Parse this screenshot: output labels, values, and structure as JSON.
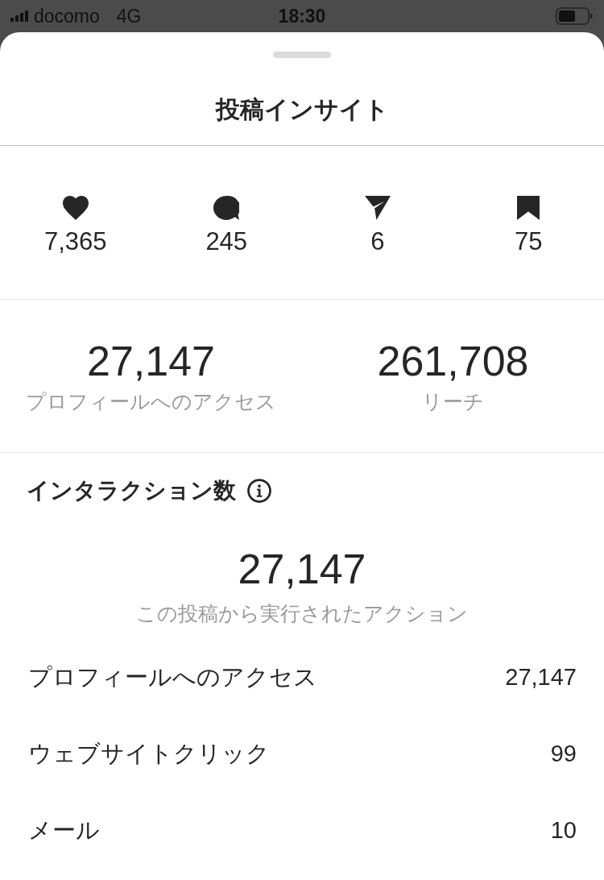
{
  "status_bar": {
    "carrier": "docomo",
    "network": "4G",
    "time": "18:30"
  },
  "sheet": {
    "title": "投稿インサイト"
  },
  "engagement": [
    {
      "kind": "likes",
      "value": "7,365"
    },
    {
      "kind": "comments",
      "value": "245"
    },
    {
      "kind": "shares",
      "value": "6"
    },
    {
      "kind": "saves",
      "value": "75"
    }
  ],
  "summary": [
    {
      "value": "27,147",
      "label": "プロフィールへのアクセス"
    },
    {
      "value": "261,708",
      "label": "リーチ"
    }
  ],
  "interactions": {
    "title": "インタラクション数",
    "total": "27,147",
    "total_label": "この投稿から実行されたアクション",
    "rows": [
      {
        "label": "プロフィールへのアクセス",
        "value": "27,147"
      },
      {
        "label": "ウェブサイトクリック",
        "value": "99"
      },
      {
        "label": "メール",
        "value": "10"
      }
    ]
  }
}
